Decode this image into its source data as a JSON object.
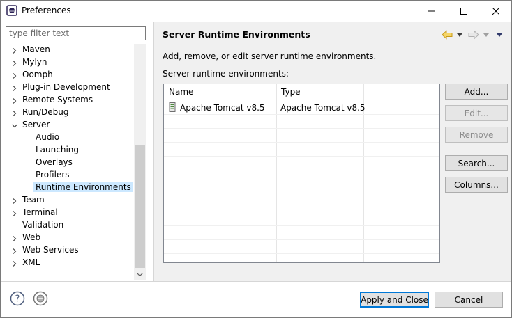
{
  "window": {
    "title": "Preferences"
  },
  "filter": {
    "placeholder": "type filter text",
    "value": ""
  },
  "tree": {
    "items": [
      {
        "label": "Maven",
        "expandable": true
      },
      {
        "label": "Mylyn",
        "expandable": true
      },
      {
        "label": "Oomph",
        "expandable": true
      },
      {
        "label": "Plug-in Development",
        "expandable": true
      },
      {
        "label": "Remote Systems",
        "expandable": true
      },
      {
        "label": "Run/Debug",
        "expandable": true
      },
      {
        "label": "Server",
        "expandable": true,
        "expanded": true
      },
      {
        "label": "Audio",
        "child": true
      },
      {
        "label": "Launching",
        "child": true
      },
      {
        "label": "Overlays",
        "child": true
      },
      {
        "label": "Profilers",
        "child": true
      },
      {
        "label": "Runtime Environments",
        "child": true,
        "selected": true
      },
      {
        "label": "Team",
        "expandable": true
      },
      {
        "label": "Terminal",
        "expandable": true
      },
      {
        "label": "Validation",
        "expandable": false
      },
      {
        "label": "Web",
        "expandable": true
      },
      {
        "label": "Web Services",
        "expandable": true
      },
      {
        "label": "XML",
        "expandable": true
      }
    ]
  },
  "page": {
    "title": "Server Runtime Environments",
    "description": "Add, remove, or edit server runtime environments.",
    "list_label": "Server runtime environments:"
  },
  "table": {
    "columns": [
      "Name",
      "Type"
    ],
    "rows": [
      {
        "name": "Apache Tomcat v8.5",
        "type": "Apache Tomcat v8.5"
      }
    ]
  },
  "side_buttons": {
    "add": "Add...",
    "edit": "Edit...",
    "remove": "Remove",
    "search": "Search...",
    "columns": "Columns..."
  },
  "bottom": {
    "apply_close": "Apply and Close",
    "cancel": "Cancel"
  },
  "colors": {
    "selection": "#cce8ff",
    "nav_back": "#f5c542",
    "button_face": "#e1e1e1",
    "default_border": "#0078d7"
  },
  "icons": {
    "app": "eclipse-icon",
    "help": "help-icon",
    "import": "import-export-icon",
    "server": "tomcat-server-icon"
  }
}
